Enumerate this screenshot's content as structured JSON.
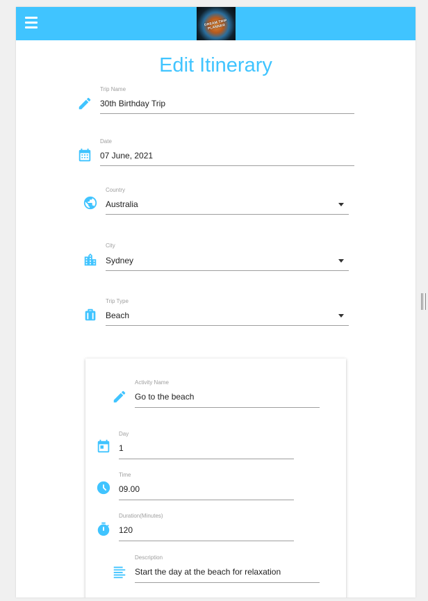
{
  "app": {
    "logo_text": "DREAM TRIP PLANNER"
  },
  "header": {
    "title": "Edit Itinerary"
  },
  "form": {
    "trip_name": {
      "label": "Trip Name",
      "value": "30th Birthday Trip"
    },
    "date": {
      "label": "Date",
      "value": "07 June, 2021"
    },
    "country": {
      "label": "Country",
      "value": "Australia"
    },
    "city": {
      "label": "City",
      "value": "Sydney"
    },
    "trip_type": {
      "label": "Trip Type",
      "value": "Beach"
    }
  },
  "activity": {
    "name": {
      "label": "Activity Name",
      "value": "Go to the beach"
    },
    "day": {
      "label": "Day",
      "value": "1"
    },
    "time": {
      "label": "Time",
      "value": "09.00"
    },
    "duration": {
      "label": "Duration(Minutes)",
      "value": "120"
    },
    "description": {
      "label": "Description",
      "value": "Start the day at the beach for relaxation"
    }
  },
  "colors": {
    "accent": "#40c4ff",
    "underline": "#9e9e9e"
  },
  "icons": [
    "menu-icon",
    "pencil-icon",
    "calendar-icon",
    "globe-icon",
    "city-icon",
    "suitcase-icon",
    "calendar-today-icon",
    "clock-icon",
    "timer-icon",
    "text-align-icon"
  ]
}
